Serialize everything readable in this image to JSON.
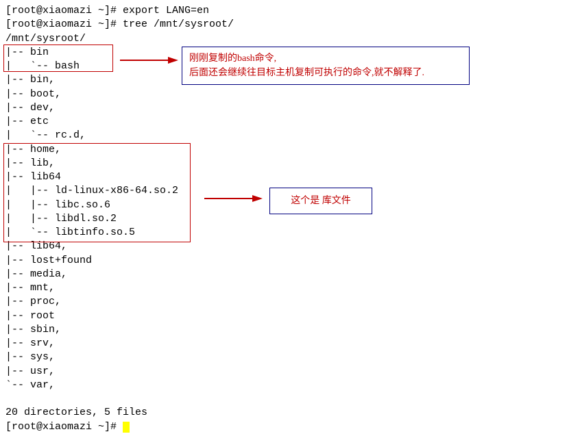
{
  "terminal": {
    "prompt": "[root@xiaomazi ~]# ",
    "cmd1": "export LANG=en",
    "cmd2": "tree /mnt/sysroot/",
    "path": "/mnt/sysroot/",
    "tree": [
      "|-- bin",
      "|   `-- bash",
      "|-- bin,",
      "|-- boot,",
      "|-- dev,",
      "|-- etc",
      "|   `-- rc.d,",
      "|-- home,",
      "|-- lib,",
      "|-- lib64",
      "|   |-- ld-linux-x86-64.so.2",
      "|   |-- libc.so.6",
      "|   |-- libdl.so.2",
      "|   `-- libtinfo.so.5",
      "|-- lib64,",
      "|-- lost+found",
      "|-- media,",
      "|-- mnt,",
      "|-- proc,",
      "|-- root",
      "|-- sbin,",
      "|-- srv,",
      "|-- sys,",
      "|-- usr,",
      "`-- var,"
    ],
    "summary": "20 directories, 5 files"
  },
  "annotations": {
    "a1_line1": "刚刚复制的bash命令,",
    "a1_line2": "后面还会继续往目标主机复制可执行的命令,就不解释了.",
    "a2": "这个是 库文件"
  }
}
